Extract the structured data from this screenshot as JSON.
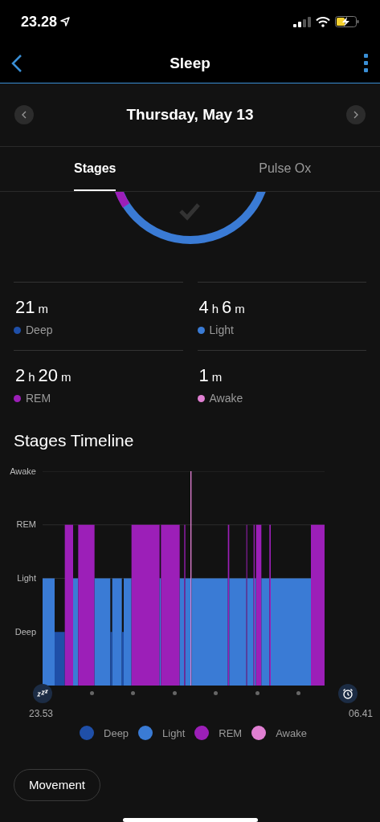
{
  "status_bar": {
    "time": "23.28"
  },
  "header": {
    "title": "Sleep"
  },
  "date_nav": {
    "date": "Thursday, May 13"
  },
  "tabs": [
    {
      "label": "Stages",
      "selected": true
    },
    {
      "label": "Pulse Ox",
      "selected": false
    }
  ],
  "stats": [
    {
      "parts": [
        {
          "number": "21",
          "unit": "m"
        }
      ],
      "label": "Deep",
      "color": "#1f4fa8"
    },
    {
      "parts": [
        {
          "number": "4",
          "unit": "h"
        },
        {
          "number": "6",
          "unit": "m"
        }
      ],
      "label": "Light",
      "color": "#3a7bd5"
    },
    {
      "parts": [
        {
          "number": "2",
          "unit": "h"
        },
        {
          "number": "20",
          "unit": "m"
        }
      ],
      "label": "REM",
      "color": "#9c1fb8"
    },
    {
      "parts": [
        {
          "number": "1",
          "unit": "m"
        }
      ],
      "label": "Awake",
      "color": "#e07fd2"
    }
  ],
  "timeline": {
    "title": "Stages Timeline",
    "axis_labels": [
      "Awake",
      "REM",
      "Light",
      "Deep"
    ],
    "start_time": "23.53",
    "end_time": "06.41"
  },
  "legend": [
    {
      "label": "Deep",
      "color": "#1f4fa8"
    },
    {
      "label": "Light",
      "color": "#3a7bd5"
    },
    {
      "label": "REM",
      "color": "#9c1fb8"
    },
    {
      "label": "Awake",
      "color": "#e07fd2"
    }
  ],
  "button": "Movement"
}
